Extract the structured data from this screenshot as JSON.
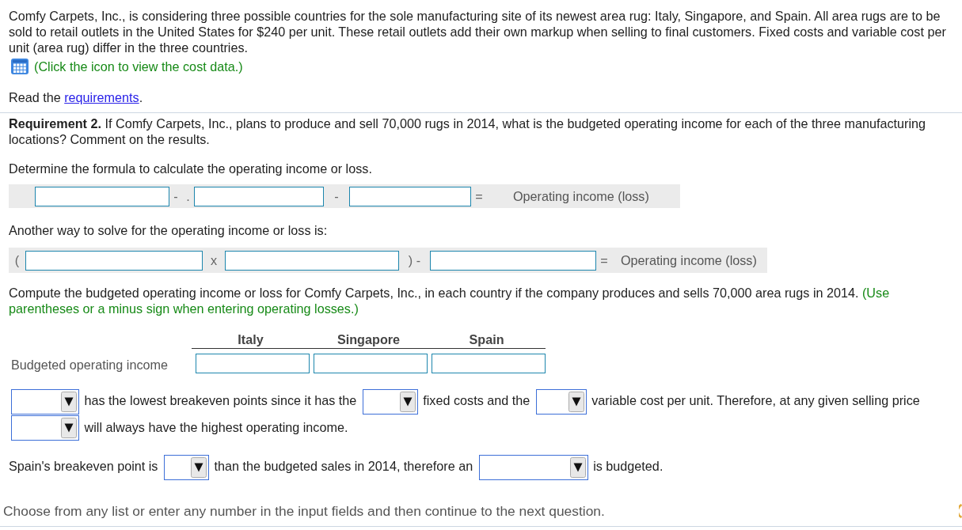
{
  "intro": {
    "text": "Comfy Carpets, Inc., is considering three possible countries for the sole manufacturing site of its newest area rug: Italy, Singapore, and Spain. All area rugs are to be sold to retail outlets in the United States for $240 per unit. These retail outlets add their own markup when selling to final customers. Fixed costs and variable cost per unit (area rug) differ in the three countries.",
    "data_link": "(Click the icon to view the cost data.)",
    "requirements_line": {
      "before": "Read the",
      "link": "requirements",
      "after": "."
    }
  },
  "requirement": "**Requirement 2.** If Comfy Carpets, Inc., plans to produce and sell 70,000 rugs in 2014, what is the budgeted operating income for each of the three manufacturing locations? Comment on the results.",
  "formulas": [
    {
      "instruction": "Determine the formula to calculate the operating income or loss.",
      "terms": [
        {
          "kind": "input"
        },
        {
          "kind": "symbol",
          "text": "-"
        },
        {
          "kind": "symbol",
          "text": "."
        },
        {
          "kind": "input"
        },
        {
          "kind": "symbol",
          "text": "-"
        },
        {
          "kind": "input"
        },
        {
          "kind": "symbol",
          "text": "="
        },
        {
          "kind": "result",
          "text": "Operating income (loss)"
        }
      ]
    },
    {
      "instruction": "Another way to solve for the operating income or loss is:",
      "terms": [
        {
          "kind": "symbol",
          "text": "("
        },
        {
          "kind": "input"
        },
        {
          "kind": "symbol",
          "text": "x"
        },
        {
          "kind": "input"
        },
        {
          "kind": "symbol",
          "text": ") -"
        },
        {
          "kind": "input"
        },
        {
          "kind": "symbol",
          "text": "="
        },
        {
          "kind": "result",
          "text": "Operating income (loss)"
        }
      ]
    }
  ],
  "compute": {
    "text": "Compute the budgeted operating income or loss for Comfy Carpets, Inc., in each country if the company produces and sells 70,000 area rugs in 2014.",
    "note": "(Use parentheses or a minus sign when entering operating losses.)",
    "table": {
      "columns": [
        "Italy",
        "Singapore",
        "Spain"
      ],
      "rows": [
        {
          "label": "Budgeted operating income",
          "cells": [
            {
              "kind": "input"
            },
            {
              "kind": "input"
            },
            {
              "kind": "input"
            }
          ]
        }
      ]
    }
  },
  "statements": [
    {
      "parts": [
        {
          "kind": "dropdown"
        },
        {
          "kind": "text",
          "text": "has the lowest breakeven points since it has the"
        },
        {
          "kind": "dropdown"
        },
        {
          "kind": "text",
          "text": "fixed costs and the"
        },
        {
          "kind": "dropdown"
        },
        {
          "kind": "text",
          "text": "variable cost per unit. Therefore, at any given selling price"
        },
        {
          "kind": "dropdown"
        },
        {
          "kind": "text",
          "text": "will always have the highest operating income."
        }
      ]
    },
    {
      "parts": [
        {
          "kind": "text",
          "text": "Spain's breakeven point is"
        },
        {
          "kind": "dropdown"
        },
        {
          "kind": "text",
          "text": "than the budgeted sales in 2014, therefore an"
        },
        {
          "kind": "dropdown"
        },
        {
          "kind": "text",
          "text": "is budgeted."
        }
      ]
    }
  ],
  "footer": {
    "text": "Choose from any list or enter any number in the input fields and then continue to the next question."
  }
}
